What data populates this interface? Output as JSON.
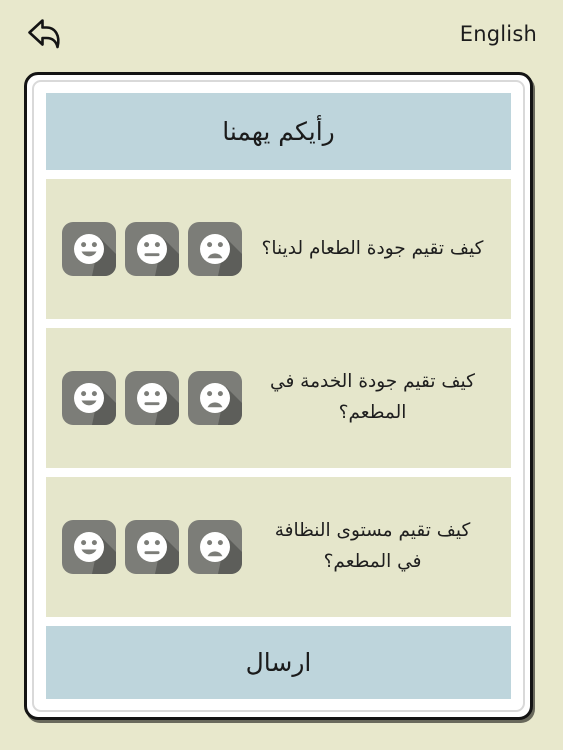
{
  "topbar": {
    "back_icon": "back-arrow-icon",
    "language_label": "English"
  },
  "survey": {
    "title": "رأيكم يهمنا",
    "submit_label": "ارسال",
    "rating_options": [
      {
        "name": "happy",
        "icon": "happy-face-icon"
      },
      {
        "name": "neutral",
        "icon": "neutral-face-icon"
      },
      {
        "name": "sad",
        "icon": "sad-face-icon"
      }
    ],
    "questions": [
      {
        "text": "كيف تقيم جودة الطعام لدينا؟"
      },
      {
        "text": "كيف تقيم جودة الخدمة في المطعم؟"
      },
      {
        "text": "كيف تقيم مستوى النظافة في المطعم؟"
      }
    ]
  },
  "colors": {
    "page_background": "#e8e8cc",
    "panel_accent": "#bed5dc",
    "question_background": "#e5e6cb",
    "face_button_background": "#7c7d78",
    "face_color": "#ffffff",
    "frame_border": "#141414",
    "text": "#1b1b1b"
  }
}
